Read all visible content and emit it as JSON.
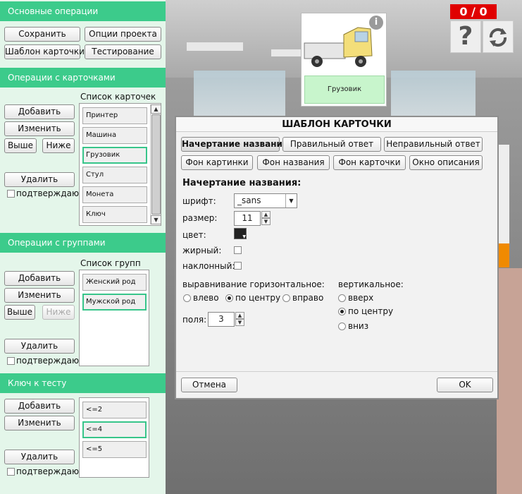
{
  "left": {
    "basic": {
      "title": "Основные операции",
      "save": "Сохранить",
      "project_options": "Опции проекта",
      "card_template": "Шаблон карточки",
      "testing": "Тестирование"
    },
    "cards": {
      "title": "Операции с карточками",
      "list_label": "Список карточек",
      "add": "Добавить",
      "edit": "Изменить",
      "up": "Выше",
      "down": "Ниже",
      "delete": "Удалить",
      "confirm": "подтверждаю",
      "items": [
        "Принтер",
        "Машина",
        "Грузовик",
        "Стул",
        "Монета",
        "Ключ"
      ],
      "selected_index": 2
    },
    "groups": {
      "title": "Операции с группами",
      "list_label": "Список групп",
      "add": "Добавить",
      "edit": "Изменить",
      "up": "Выше",
      "down": "Ниже",
      "delete": "Удалить",
      "confirm": "подтверждаю",
      "items": [
        "Женский род",
        "Мужской род"
      ],
      "selected_index": 1
    },
    "key": {
      "title": "Ключ к тесту",
      "add": "Добавить",
      "edit": "Изменить",
      "delete": "Удалить",
      "confirm": "подтверждаю",
      "items": [
        "<=2",
        "<=4",
        "<=5"
      ],
      "selected_index": 1
    }
  },
  "scene": {
    "card_label": "Грузовик",
    "info_icon": "info-icon",
    "score": "0 / 0",
    "help_glyph": "?",
    "refresh_icon": "refresh-icon"
  },
  "dialog": {
    "title": "ШАБЛОН КАРТОЧКИ",
    "tabs": {
      "title_style": "Начертание названия",
      "correct": "Правильный ответ",
      "wrong": "Неправильный ответ",
      "img_bg": "Фон картинки",
      "title_bg": "Фон названия",
      "card_bg": "Фон карточки",
      "desc_window": "Окно описания"
    },
    "section_title": "Начертание названия:",
    "font_label": "шрифт:",
    "font_value": "_sans",
    "size_label": "размер:",
    "size_value": "11",
    "color_label": "цвет:",
    "color_value": "#222222",
    "bold_label": "жирный:",
    "italic_label": "наклонный:",
    "halign_label": "выравнивание горизонтальное:",
    "halign_options": [
      "влево",
      "по центру",
      "вправо"
    ],
    "halign_selected": 1,
    "valign_label": "вертикальное:",
    "valign_options": [
      "вверх",
      "по центру",
      "вниз"
    ],
    "valign_selected": 1,
    "margin_label": "поля:",
    "margin_value": "3",
    "cancel": "Отмена",
    "ok": "OK"
  },
  "colors": {
    "accent": "#3ccb8b",
    "panel_bg": "#e4f6ea",
    "score_bg": "#e00000"
  }
}
